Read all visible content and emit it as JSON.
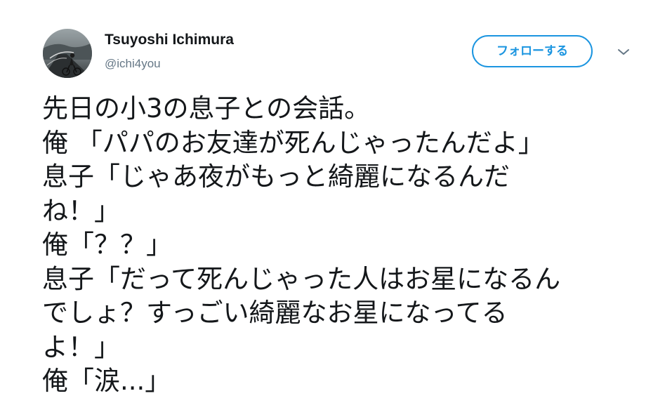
{
  "author": {
    "display_name": "Tsuyoshi Ichimura",
    "handle": "@ichi4you"
  },
  "follow_button": {
    "label": "フォローする"
  },
  "icons": {
    "avatar": "profile-photo-cyclist-on-road",
    "caret": "chevron-down-icon"
  },
  "colors": {
    "accent": "#1b95e0",
    "text": "#14171a",
    "secondary_text": "#657786"
  },
  "tweet": {
    "lines": [
      "先日の小3の息子との会話。",
      "俺 「パパのお友達が死んじゃったんだよ」",
      "息子「じゃあ夜がもっと綺麗になるんだ",
      "ね！」",
      "俺「？？」",
      "息子「だって死んじゃった人はお星になるん",
      "でしょ？すっごい綺麗なお星になってる",
      "よ！」",
      "俺「涙...」"
    ]
  }
}
